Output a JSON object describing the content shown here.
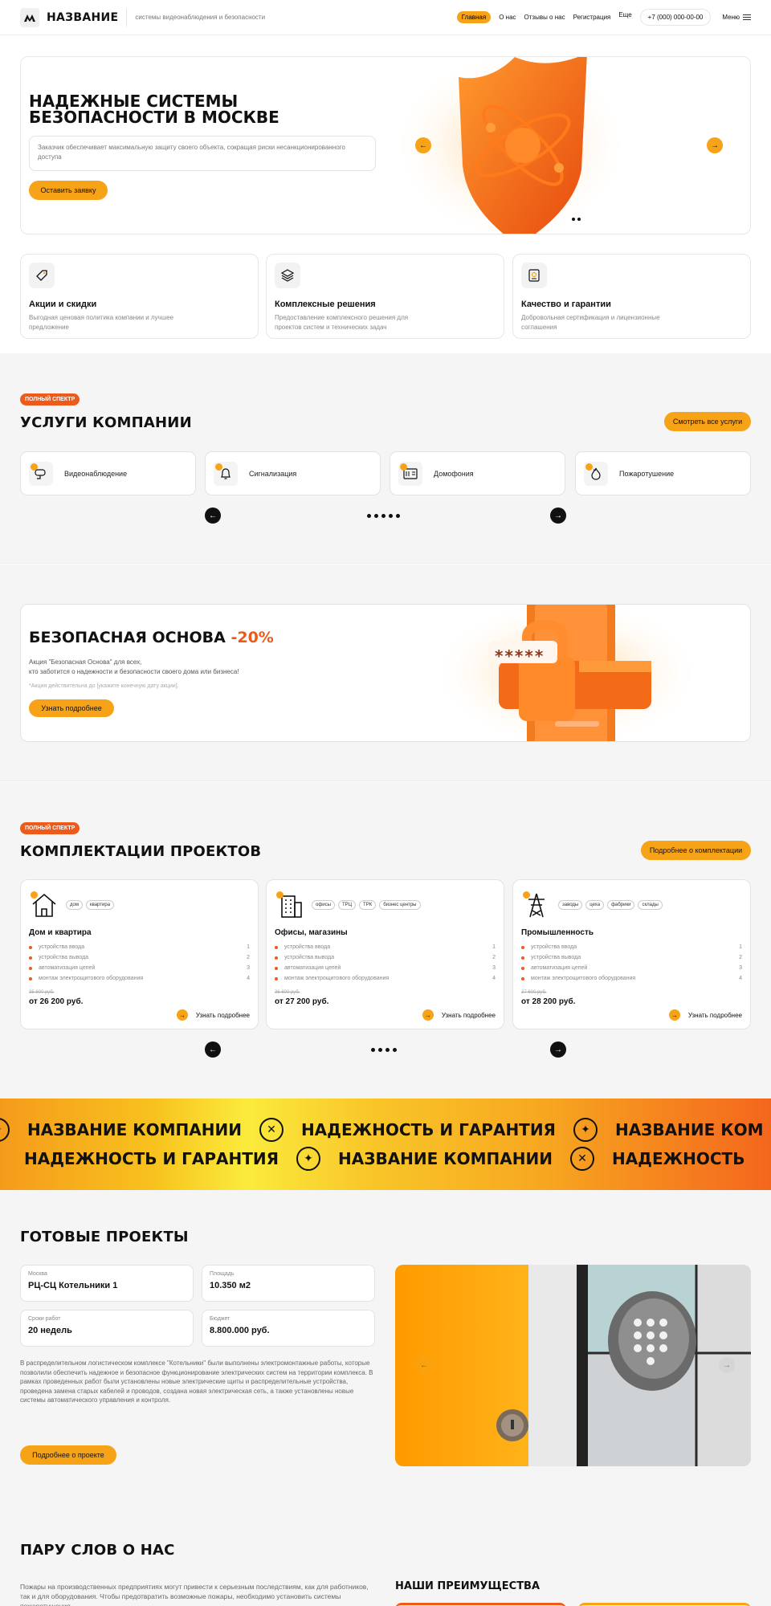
{
  "header": {
    "logo_text": "НАЗВАНИЕ",
    "tagline": "системы видеонаблюдения и безопасности",
    "nav": [
      "Главная",
      "О нас",
      "Отзывы о нас",
      "Регистрация",
      "Еще"
    ],
    "phone": "+7 (000) 000-00-00",
    "menu_label": "Меню"
  },
  "hero": {
    "title": "НАДЕЖНЫЕ СИСТЕМЫ БЕЗОПАСНОСТИ В МОСКВЕ",
    "description": "Заказчик обеспечивает максимальную защиту своего объекта, сокращая риски несанкционированного доступа",
    "cta": "Оставить заявку",
    "prev": "←",
    "next": "→"
  },
  "features": [
    {
      "title": "Акции и скидки",
      "text": "Выгодная ценовая политика компании и лучшее предложение"
    },
    {
      "title": "Комплексные решения",
      "text": "Предоставление комплексного решения для проектов систем и технических задач"
    },
    {
      "title": "Качество и гарантии",
      "text": "Добровольная сертификация и лицензионные соглашения"
    }
  ],
  "services": {
    "badge": "ПОЛНЫЙ СПЕКТР",
    "title": "УСЛУГИ КОМПАНИИ",
    "all_button": "Смотреть все услуги",
    "items": [
      "Видеонаблюдение",
      "Сигнализация",
      "Домофония",
      "Пожаротушение"
    ],
    "prev": "←",
    "next": "→"
  },
  "promo": {
    "title": "БЕЗОПАСНАЯ ОСНОВА",
    "discount": "-20%",
    "line1": "Акция \"Безопасная Основа\" для всех,",
    "line2": "кто заботится о надежности и безопасности своего дома или бизнеса!",
    "note": "*Акция действительна до [укажите конечную дату акции].",
    "cta": "Узнать подробнее",
    "stars": "*****"
  },
  "projects": {
    "badge": "ПОЛНЫЙ СПЕКТР",
    "title": "КОМПЛЕКТАЦИИ ПРОЕКТОВ",
    "more_button": "Подробнее о комплектации",
    "cards": [
      {
        "name": "Дом и квартира",
        "tags": [
          "дом",
          "квартира"
        ],
        "old_price": "35 600 руб.",
        "price": "от 26 200 руб.",
        "more": "Узнать подробнее",
        "items": [
          [
            "устройства ввода",
            "1"
          ],
          [
            "устройства вывода",
            "2"
          ],
          [
            "автоматизация цепей",
            "3"
          ],
          [
            "монтаж электрощитового оборудования",
            "4"
          ]
        ]
      },
      {
        "name": "Офисы, магазины",
        "tags": [
          "офисы",
          "ТРЦ",
          "ТРК",
          "бизнес центры"
        ],
        "old_price": "36 600 руб.",
        "price": "от 27 200 руб.",
        "more": "Узнать подробнее",
        "items": [
          [
            "устройства ввода",
            "1"
          ],
          [
            "устройства вывода",
            "2"
          ],
          [
            "автоматизация цепей",
            "3"
          ],
          [
            "монтаж электрощитового оборудования",
            "4"
          ]
        ]
      },
      {
        "name": "Промышленность",
        "tags": [
          "заводы",
          "цеха",
          "фабрики",
          "склады"
        ],
        "old_price": "37 600 руб.",
        "price": "от 28 200 руб.",
        "more": "Узнать подробнее",
        "items": [
          [
            "устройства ввода",
            "1"
          ],
          [
            "устройства вывода",
            "2"
          ],
          [
            "автоматизация цепей",
            "3"
          ],
          [
            "монтаж электрощитового оборудования",
            "4"
          ]
        ]
      }
    ],
    "prev": "←",
    "next": "→"
  },
  "marquee": {
    "company": "НАЗВАНИЕ КОМПАНИИ",
    "company_cut": "НАЗВАНИЕ КОМ",
    "reliability": "НАДЕЖНОСТЬ И ГАРАНТИЯ",
    "reliability_cut": "НАДЕЖНОСТЬ"
  },
  "ready": {
    "title": "ГОТОВЫЕ ПРОЕКТЫ",
    "facts": [
      {
        "label": "Москва",
        "value": "РЦ-СЦ Котельники 1"
      },
      {
        "label": "Площадь",
        "value": "10.350 м2"
      },
      {
        "label": "Сроки работ",
        "value": "20 недель"
      },
      {
        "label": "Бюджет",
        "value": "8.800.000 руб."
      }
    ],
    "description": "В распределительном логистическом комплексе \"Котельники\" были выполнены электромонтажные работы, которые позволили обеспечить надежное и безопасное функционирование электрических систем на территории комплекса. В рамках проведенных работ были установлены новые электрические щиты и распределительные устройства, проведена замена старых кабелей и проводов, создана новая электрическая сеть, а также установлены новые системы автоматического управления и контроля.",
    "cta": "Подробнее о проекте",
    "prev": "←",
    "next": "→"
  },
  "about": {
    "title": "ПАРУ СЛОВ О НАС",
    "text": "Пожары на производственных предприятиях могут привести к серьезным последствиям, как для работников, так и для оборудования. Чтобы предотвратить возможные пожары, необходимо установить системы пожаротушения.",
    "advantages_title": "НАШИ ПРЕИМУЩЕСТВА"
  },
  "colors": {
    "accent": "#f7a318",
    "badge": "#ee5a1a",
    "section_bg": "#f5f5f5"
  }
}
